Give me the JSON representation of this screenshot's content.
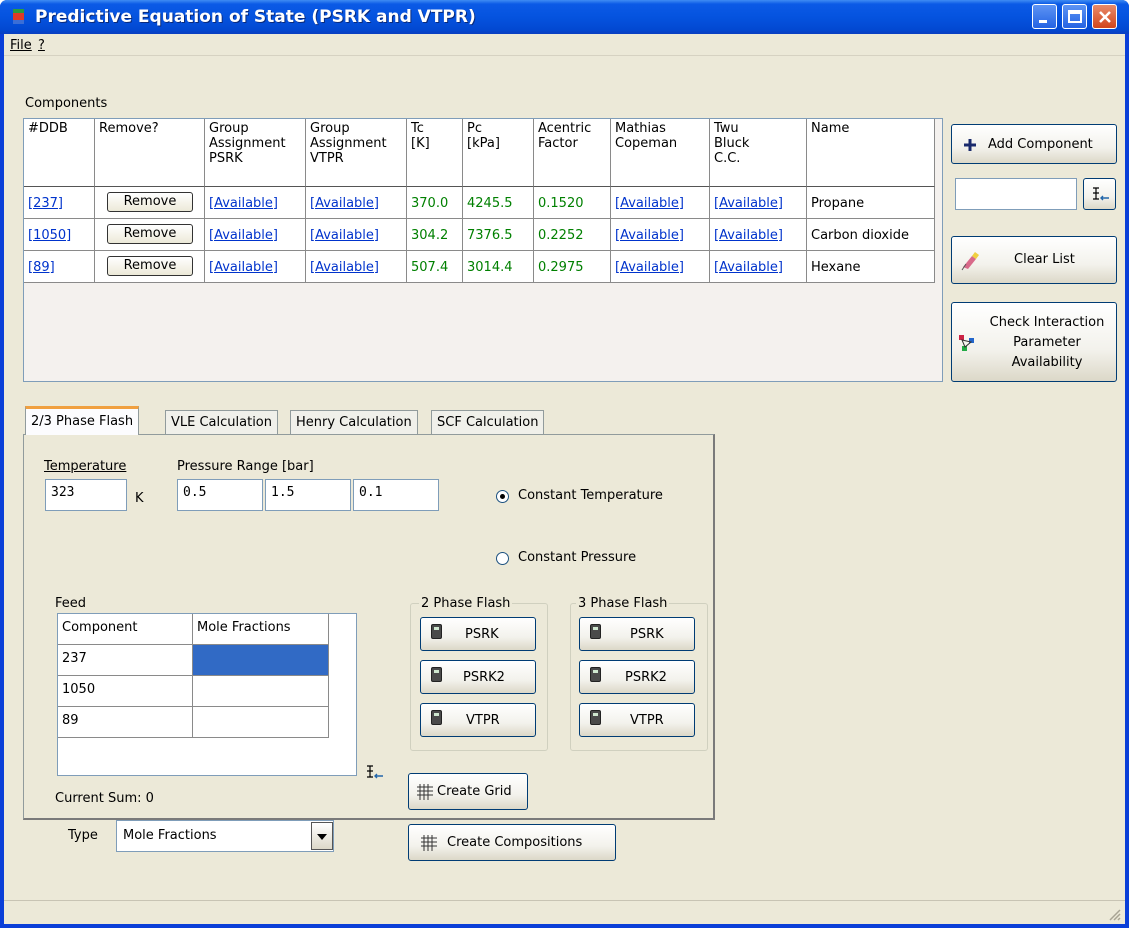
{
  "window": {
    "title": "Predictive Equation of State (PSRK and VTPR)"
  },
  "menu": {
    "file": "File",
    "help": "?"
  },
  "components": {
    "label": "Components",
    "headers": {
      "ddb": "#DDB",
      "remove": "Remove?",
      "psrk_l1": "Group",
      "psrk_l2": "Assignment",
      "psrk_l3": "PSRK",
      "vtpr_l1": "Group",
      "vtpr_l2": "Assignment",
      "vtpr_l3": "VTPR",
      "tc_l1": "Tc",
      "tc_l2": "[K]",
      "pc_l1": "Pc",
      "pc_l2": "[kPa]",
      "acentric_l1": "Acentric",
      "acentric_l2": "Factor",
      "mathias_l1": "Mathias",
      "mathias_l2": "Copeman",
      "twu_l1": "Twu",
      "twu_l2": "Bluck",
      "twu_l3": "C.C.",
      "name": "Name"
    },
    "rows": [
      {
        "ddb": "[237]",
        "remove": "Remove",
        "psrk": "[Available]",
        "vtpr": "[Available]",
        "tc": "370.0",
        "pc": "4245.5",
        "acentric": "0.1520",
        "mathias": "[Available]",
        "twu": "[Available]",
        "name": "Propane"
      },
      {
        "ddb": "[1050]",
        "remove": "Remove",
        "psrk": "[Available]",
        "vtpr": "[Available]",
        "tc": "304.2",
        "pc": "7376.5",
        "acentric": "0.2252",
        "mathias": "[Available]",
        "twu": "[Available]",
        "name": "Carbon dioxide"
      },
      {
        "ddb": "[89]",
        "remove": "Remove",
        "psrk": "[Available]",
        "vtpr": "[Available]",
        "tc": "507.4",
        "pc": "3014.4",
        "acentric": "0.2975",
        "mathias": "[Available]",
        "twu": "[Available]",
        "name": "Hexane"
      }
    ]
  },
  "side": {
    "add_component": "Add Component",
    "add_input_value": "",
    "clear_list": "Clear List",
    "check_l1": "Check Interaction",
    "check_l2": "Parameter",
    "check_l3": "Availability"
  },
  "tabs": [
    "2/3 Phase Flash",
    "VLE Calculation",
    "Henry Calculation",
    "SCF Calculation"
  ],
  "flash": {
    "temperature_label": "Temperature",
    "temperature_value": "323",
    "temperature_unit": "K",
    "pressure_label": "Pressure Range [bar]",
    "p_from": "0.5",
    "p_to": "1.5",
    "p_step": "0.1",
    "radio_const_t": "Constant Temperature",
    "radio_const_p": "Constant Pressure",
    "feed_label": "Feed",
    "feed_headers": {
      "component": "Component",
      "mole_fractions": "Mole Fractions"
    },
    "feed_rows": [
      {
        "component": "237",
        "value": ""
      },
      {
        "component": "1050",
        "value": ""
      },
      {
        "component": "89",
        "value": ""
      }
    ],
    "current_sum": "Current Sum: 0",
    "type_label": "Type",
    "type_value": "Mole Fractions",
    "two_phase_label": "2 Phase Flash",
    "three_phase_label": "3 Phase Flash",
    "two_phase_buttons": [
      "PSRK",
      "PSRK2",
      "VTPR"
    ],
    "three_phase_buttons": [
      "PSRK",
      "PSRK2",
      "VTPR"
    ],
    "create_grid": "Create Grid",
    "create_compositions": "Create Compositions"
  },
  "colors": {
    "title_bar": "#0553df",
    "face": "#ece9d8",
    "selected_cell": "#316ac5",
    "link": "#0033cc",
    "numeric": "#008000"
  }
}
